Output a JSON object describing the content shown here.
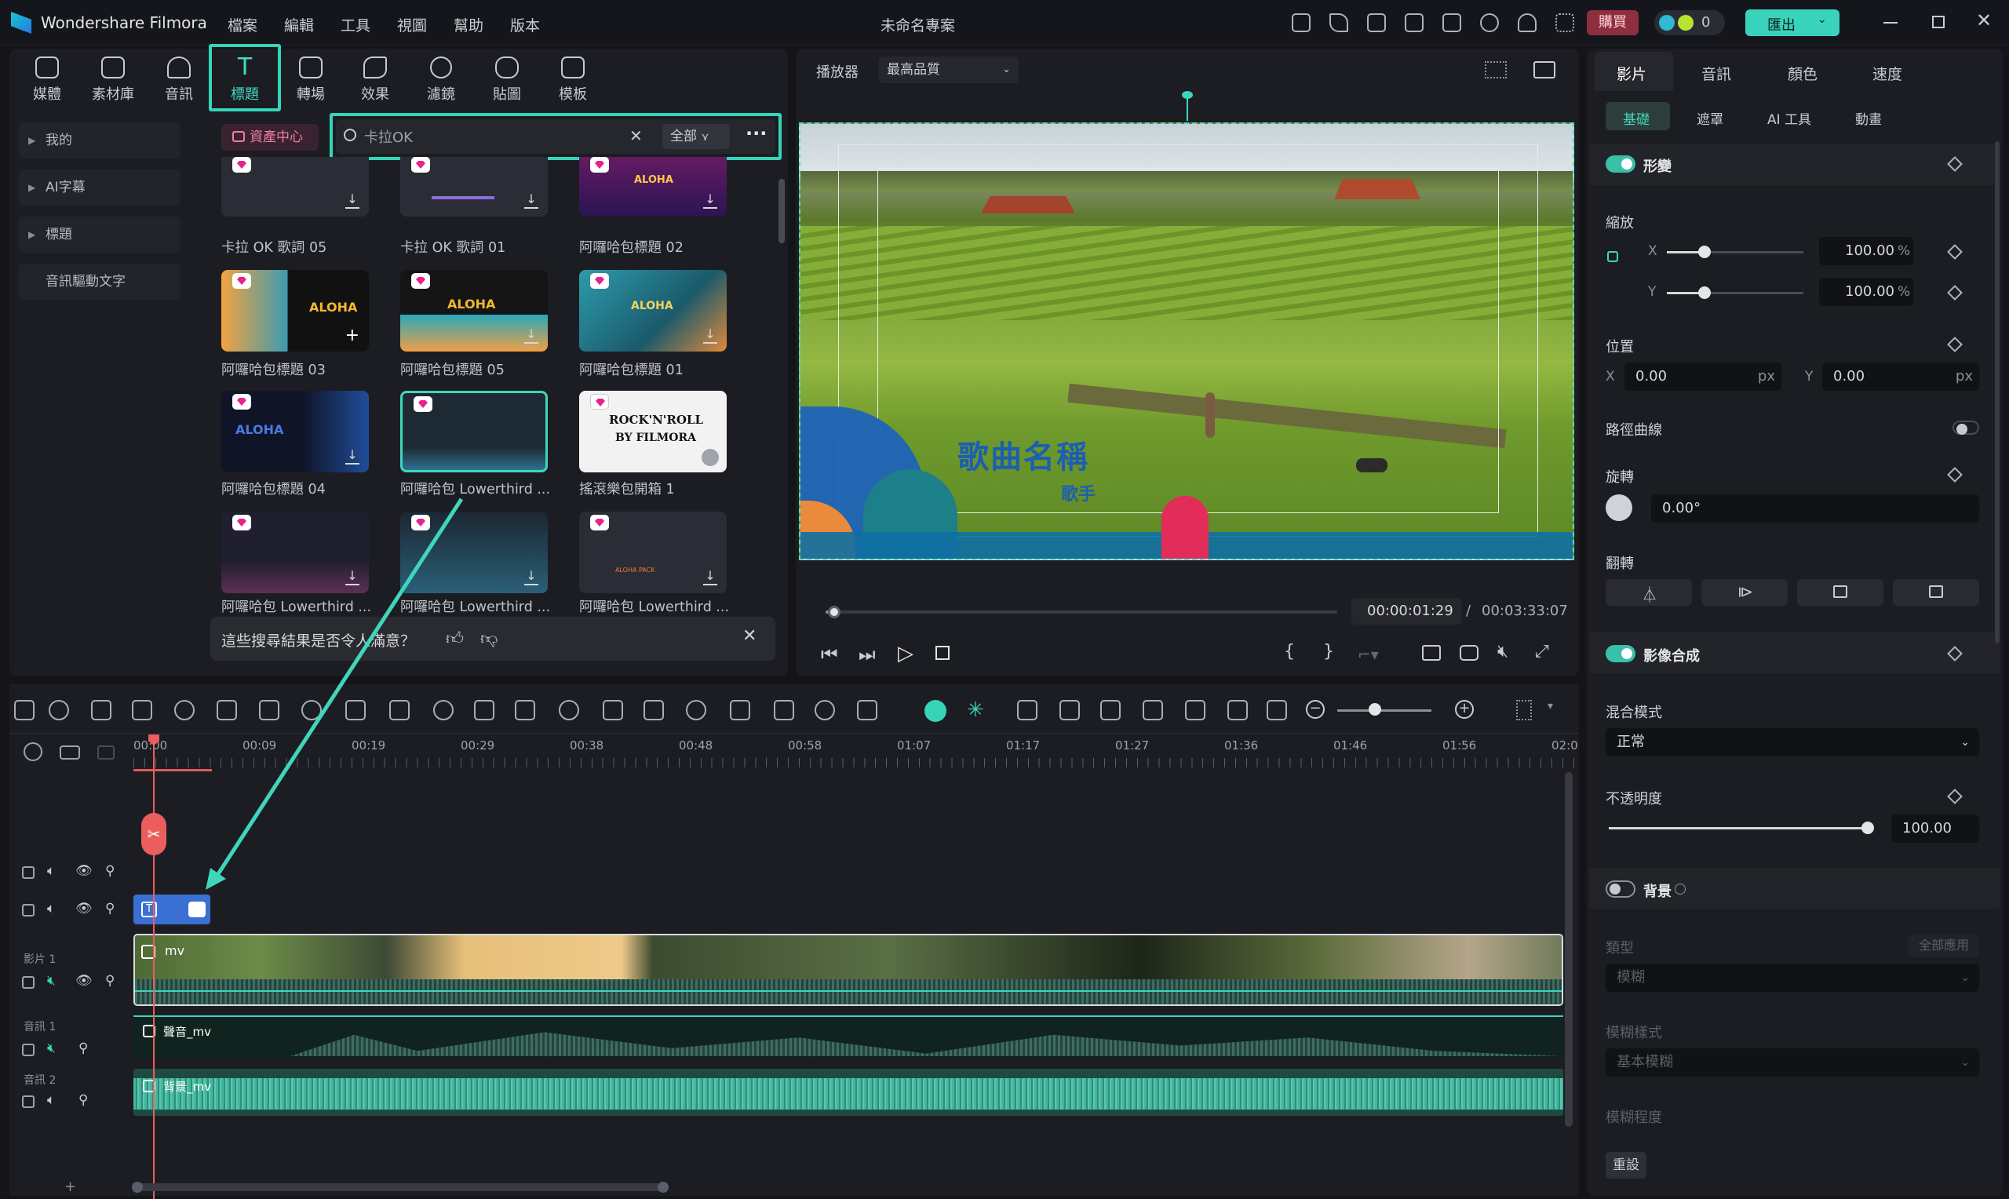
{
  "app": {
    "title": "Wondershare Filmora",
    "project_title": "未命名專案"
  },
  "menu": [
    "檔案",
    "編輯",
    "工具",
    "視圖",
    "幫助",
    "版本"
  ],
  "titlebar_buttons": {
    "buy": "購買",
    "credits": "0",
    "export": "匯出"
  },
  "toolbar": [
    {
      "label": "媒體",
      "icon": "media-icon"
    },
    {
      "label": "素材庫",
      "icon": "stock-icon"
    },
    {
      "label": "音訊",
      "icon": "audio-icon"
    },
    {
      "label": "標題",
      "icon": "title-icon",
      "active": true
    },
    {
      "label": "轉場",
      "icon": "transition-icon"
    },
    {
      "label": "效果",
      "icon": "effects-icon"
    },
    {
      "label": "濾鏡",
      "icon": "filter-icon"
    },
    {
      "label": "貼圖",
      "icon": "sticker-icon"
    },
    {
      "label": "模板",
      "icon": "template-icon"
    }
  ],
  "sidebar": [
    "我的",
    "AI字幕",
    "標題",
    "音訊驅動文字"
  ],
  "library": {
    "asset_center": "資產中心",
    "search_value": "卡拉OK",
    "filter": "全部",
    "cards": [
      {
        "label": "卡拉 OK 歌詞 05"
      },
      {
        "label": "卡拉 OK 歌詞 01"
      },
      {
        "label": "阿囉哈包標題 02"
      },
      {
        "label": "阿囉哈包標題 03"
      },
      {
        "label": "阿囉哈包標題 05"
      },
      {
        "label": "阿囉哈包標題 01"
      },
      {
        "label": "阿囉哈包標題 04"
      },
      {
        "label": "阿囉哈包 Lowerthird ..."
      },
      {
        "label": "搖滾樂包開箱 1"
      },
      {
        "label": "阿囉哈包 Lowerthird ..."
      },
      {
        "label": "阿囉哈包 Lowerthird ..."
      },
      {
        "label": "阿囉哈包 Lowerthird ..."
      }
    ],
    "feedback": "這些搜尋結果是否令人滿意？"
  },
  "thumb_text": {
    "aloha": "ALOHA",
    "pack": "PACK",
    "rock1": "ROCK'N'ROLL",
    "rock2": "BY FILMORA",
    "aloha_pack": "ALOHA PACK"
  },
  "player": {
    "label": "播放器",
    "quality": "最高品質",
    "overlay_title": "歌曲名稱",
    "overlay_sub": "歌手",
    "current_time": "00:00:01:29",
    "separator": "/",
    "total_time": "00:03:33:07",
    "progress": 0.01
  },
  "timeline": {
    "ruler": [
      "00:00",
      "00:09",
      "00:19",
      "00:29",
      "00:38",
      "00:48",
      "00:58",
      "01:07",
      "01:17",
      "01:27",
      "01:36",
      "01:46",
      "01:56",
      "02:0"
    ],
    "video_track_label": "影片 1",
    "audio1_label": "音訊 1",
    "audio2_label": "音訊 2",
    "video_clip": "mv",
    "audio1_clip": "聲音_mv",
    "audio2_clip": "背景_mv"
  },
  "right_panel": {
    "tabs": [
      "影片",
      "音訊",
      "顏色",
      "速度"
    ],
    "subtabs": [
      "基礎",
      "遮罩",
      "AI 工具",
      "動畫"
    ],
    "transform": "形變",
    "scale": "縮放",
    "scale_x": "100.00",
    "scale_y": "100.00",
    "pct": "%",
    "x": "X",
    "y": "Y",
    "position": "位置",
    "pos_x": "0.00",
    "pos_y": "0.00",
    "px": "px",
    "path_curve": "路徑曲線",
    "rotate": "旋轉",
    "rotate_value": "0.00°",
    "flip": "翻轉",
    "compositing": "影像合成",
    "blend_mode": "混合模式",
    "blend_value": "正常",
    "opacity": "不透明度",
    "opacity_value": "100.00",
    "background": "背景",
    "type": "類型",
    "apply_all": "全部應用",
    "type_value": "模糊",
    "blur_style": "模糊樣式",
    "blur_style_value": "基本模糊",
    "blur_level": "模糊程度",
    "reset": "重設"
  }
}
